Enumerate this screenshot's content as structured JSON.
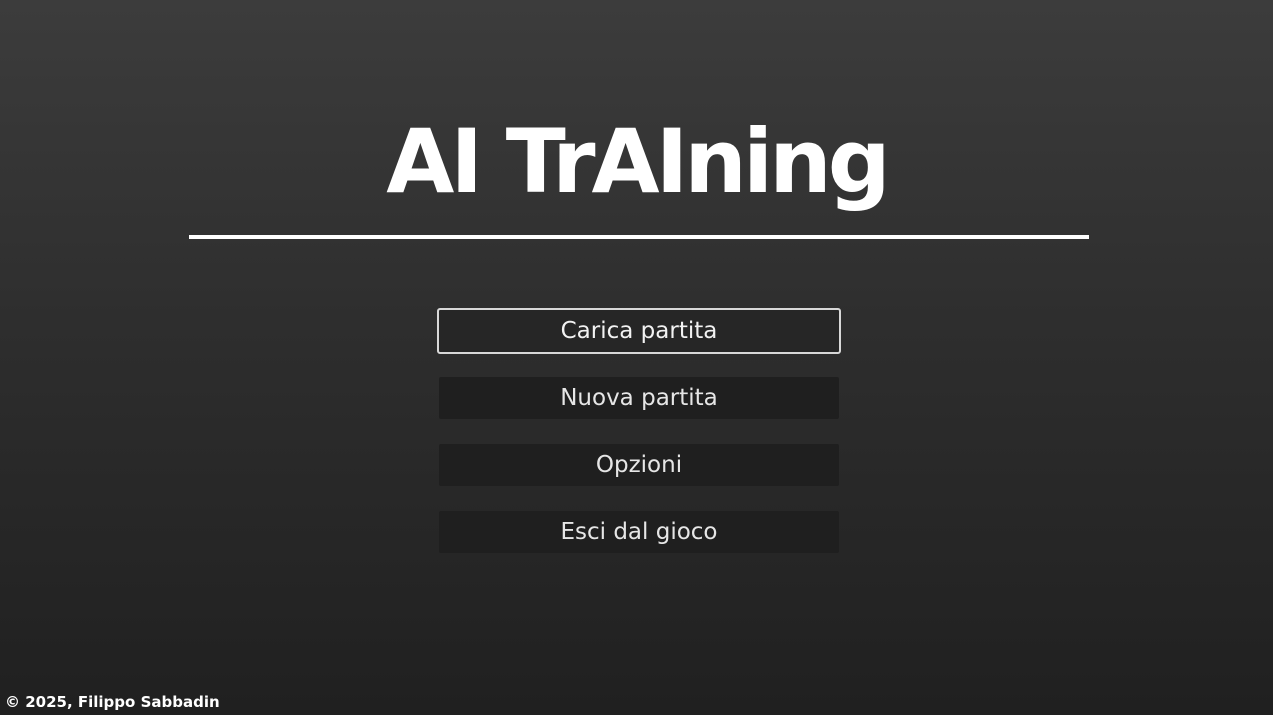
{
  "game": {
    "title": "AI TrAIning"
  },
  "menu": {
    "items": [
      {
        "label": "Carica partita",
        "selected": true
      },
      {
        "label": "Nuova partita",
        "selected": false
      },
      {
        "label": "Opzioni",
        "selected": false
      },
      {
        "label": "Esci dal gioco",
        "selected": false
      }
    ]
  },
  "footer": {
    "copyright": "© 2025, Filippo Sabbadin"
  },
  "colors": {
    "background_top": "#3c3c3c",
    "background_bottom": "#202020",
    "button_fill": "#1f1f1f",
    "selected_border": "#d8d8d8",
    "text": "#ffffff"
  }
}
